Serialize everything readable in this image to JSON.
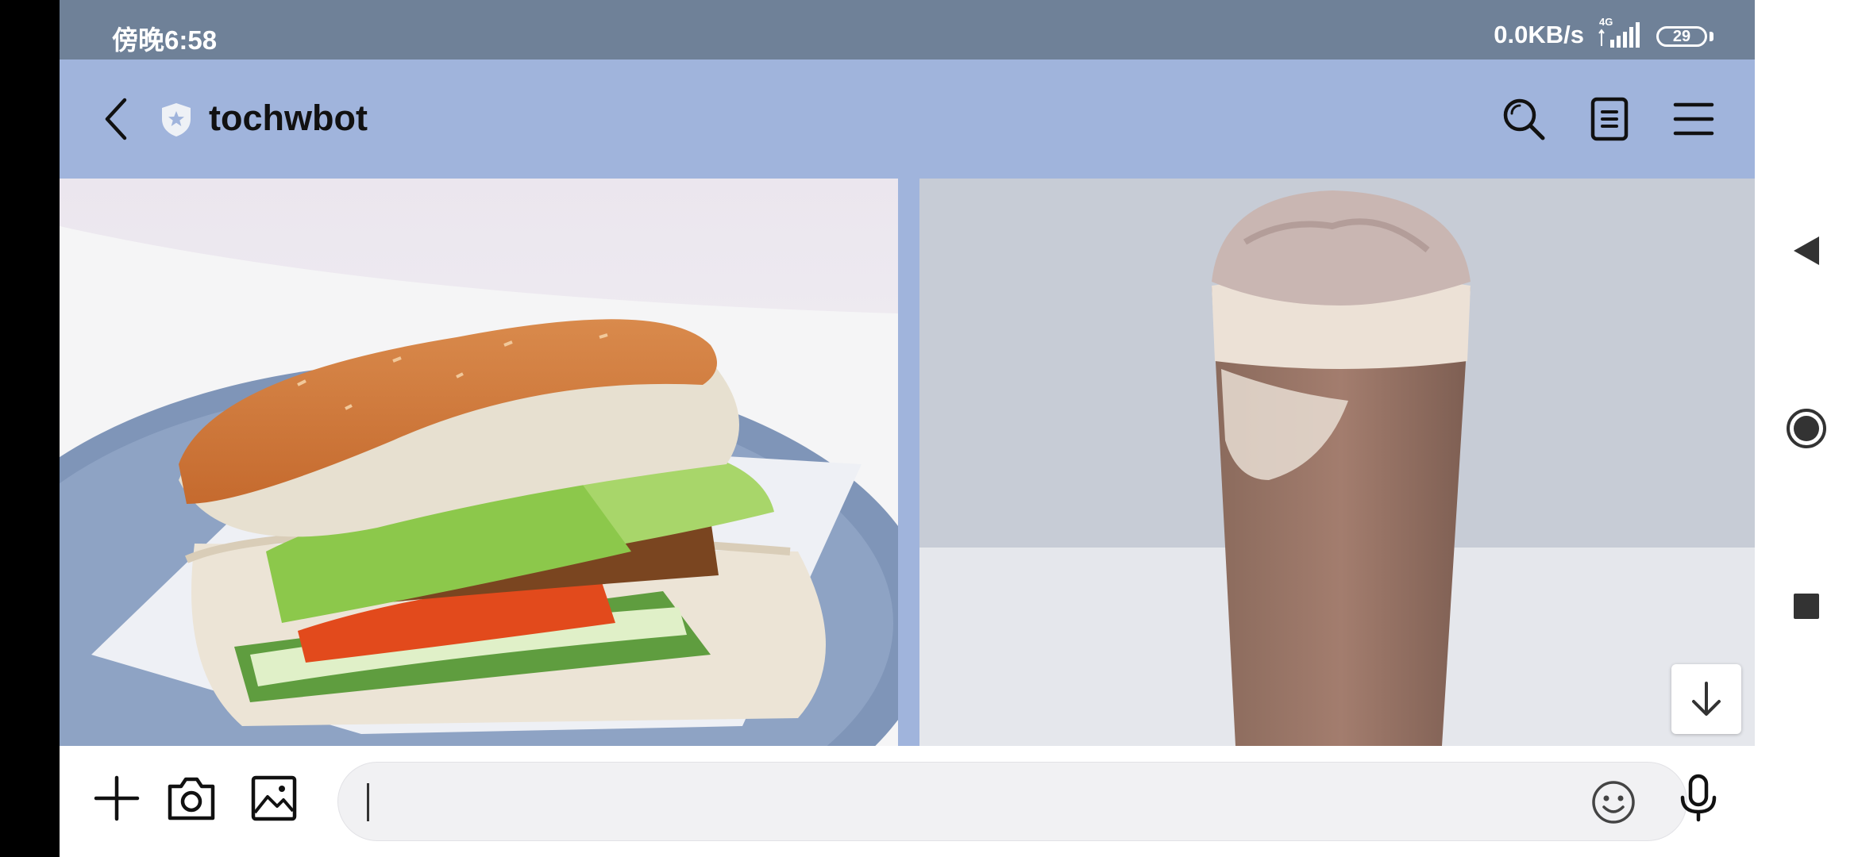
{
  "status_bar": {
    "time": "傍晚6:58",
    "net_speed": "0.0KB/s",
    "network": "4G",
    "battery": "29"
  },
  "header": {
    "title": "tochwbot"
  },
  "messages": [
    {
      "type": "image",
      "subject": "chicken-sandwich"
    },
    {
      "type": "image",
      "subject": "chocolate-frappe"
    }
  ],
  "input": {
    "value": "",
    "placeholder": ""
  },
  "colors": {
    "header_bg": "#a0b4dc",
    "status_bg": "#6f8198",
    "input_bg": "#f1f1f3"
  },
  "icons": [
    "back-arrow-icon",
    "official-account-shield-icon",
    "search-icon",
    "notes-icon",
    "menu-icon",
    "plus-icon",
    "camera-icon",
    "gallery-icon",
    "emoji-icon",
    "microphone-icon",
    "arrow-down-icon"
  ]
}
